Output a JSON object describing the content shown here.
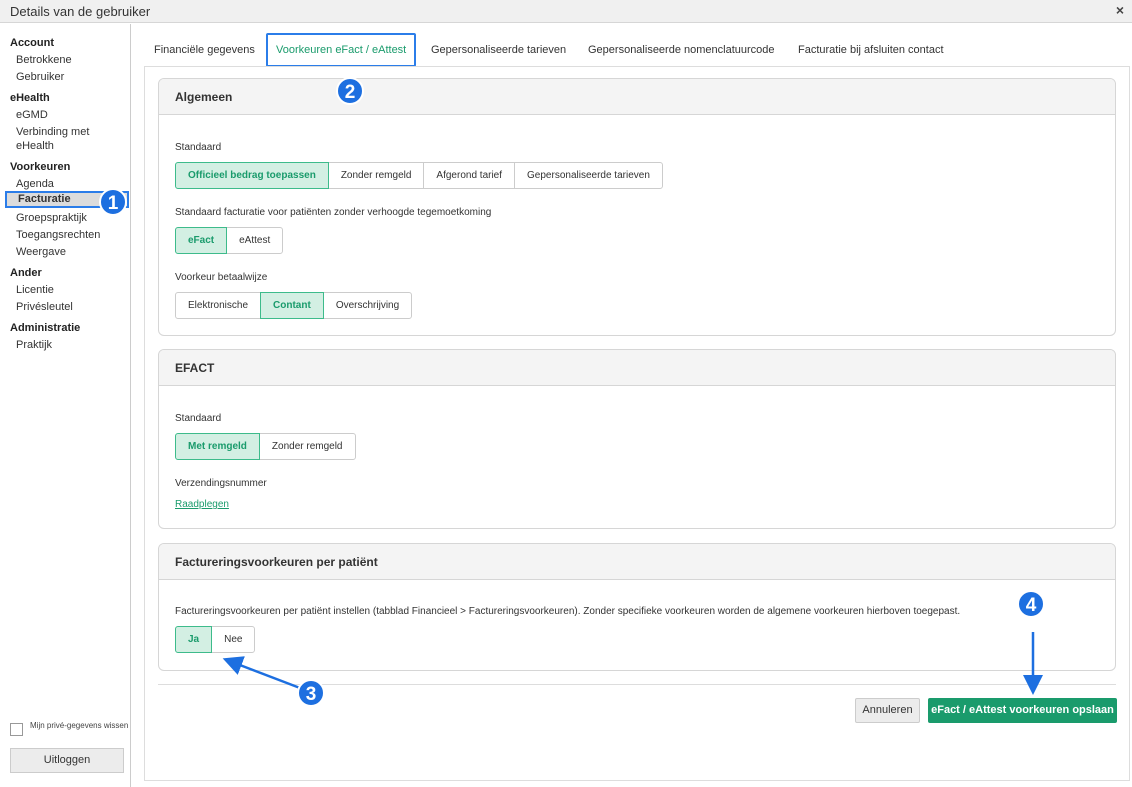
{
  "window": {
    "title": "Details van de gebruiker",
    "close_label": "×"
  },
  "sidebar": {
    "groups": [
      {
        "label": "Account",
        "items": [
          "Betrokkene",
          "Gebruiker"
        ]
      },
      {
        "label": "eHealth",
        "items": [
          "eGMD",
          "Verbinding met eHealth"
        ]
      },
      {
        "label": "Voorkeuren",
        "items": [
          "Agenda",
          "Facturatie",
          "Groepspraktijk",
          "Toegangsrechten",
          "Weergave"
        ]
      },
      {
        "label": "Ander",
        "items": [
          "Licentie",
          "Privésleutel"
        ]
      },
      {
        "label": "Administratie",
        "items": [
          "Praktijk"
        ]
      }
    ],
    "active_item": "Facturatie",
    "checkbox_label": "Mijn privé-gegevens wissen",
    "logout_label": "Uitloggen"
  },
  "tabs": [
    "Financiële gegevens",
    "Voorkeuren eFact / eAttest",
    "Gepersonaliseerde tarieven",
    "Gepersonaliseerde nomenclatuurcode",
    "Facturatie bij afsluiten contact"
  ],
  "active_tab": "Voorkeuren eFact / eAttest",
  "panels": {
    "algemeen": {
      "title": "Algemeen",
      "standaard_label": "Standaard",
      "standaard_options": [
        "Officieel bedrag toepassen",
        "Zonder remgeld",
        "Afgerond tarief",
        "Gepersonaliseerde tarieven"
      ],
      "standaard_selected": "Officieel bedrag toepassen",
      "facturatie_label": "Standaard facturatie voor patiënten zonder verhoogde tegemoetkoming",
      "facturatie_options": [
        "eFact",
        "eAttest"
      ],
      "facturatie_selected": "eFact",
      "betaalwijze_label": "Voorkeur betaalwijze",
      "betaalwijze_options": [
        "Elektronische",
        "Contant",
        "Overschrijving"
      ],
      "betaalwijze_selected": "Contant"
    },
    "efact": {
      "title": "EFACT",
      "standaard_label": "Standaard",
      "standaard_options": [
        "Met remgeld",
        "Zonder remgeld"
      ],
      "standaard_selected": "Met remgeld",
      "verzending_label": "Verzendingsnummer",
      "verzending_link": "Raadplegen"
    },
    "patient": {
      "title": "Factureringsvoorkeuren per patiënt",
      "description": "Factureringsvoorkeuren per patiënt instellen (tabblad Financieel > Factureringsvoorkeuren). Zonder specifieke voorkeuren worden de algemene voorkeuren hierboven toegepast.",
      "options": [
        "Ja",
        "Nee"
      ],
      "selected": "Ja"
    }
  },
  "footer": {
    "cancel_label": "Annuleren",
    "save_label": "eFact / eAttest voorkeuren opslaan"
  },
  "annotations": [
    "1",
    "2",
    "3",
    "4"
  ],
  "colors": {
    "accent": "#1a9b6c",
    "selected_bg": "#d3efe3",
    "highlight": "#2b7de9",
    "badge": "#1d6fe0"
  }
}
